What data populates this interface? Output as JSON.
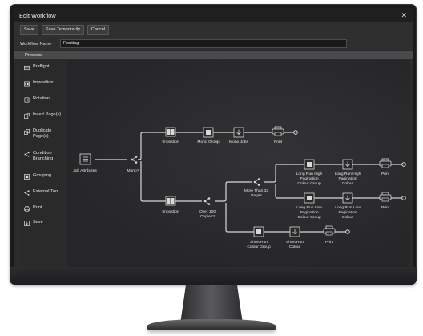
{
  "window": {
    "title": "Edit Workflow",
    "close_glyph": "✕"
  },
  "toolbar": {
    "save": "Save",
    "save_temporarily": "Save Temporarily",
    "cancel": "Cancel"
  },
  "workflow_name": {
    "label": "Workflow Name",
    "value": "Routing"
  },
  "process": {
    "header": "Process"
  },
  "tools": [
    {
      "label": "Preflight",
      "icon": "preflight-icon"
    },
    {
      "label": "Imposition",
      "icon": "imposition-icon"
    },
    {
      "label": "Rotation",
      "icon": "rotation-icon"
    },
    {
      "label": "Insert Page(s)",
      "icon": "insert-page-icon"
    },
    {
      "label": "Duplicate Page(s)",
      "icon": "duplicate-page-icon"
    },
    {
      "label": "Condition Branching",
      "icon": "branch-icon"
    },
    {
      "label": "Grouping",
      "icon": "grouping-icon"
    },
    {
      "label": "External Tool",
      "icon": "share-icon"
    },
    {
      "label": "Print",
      "icon": "printer-icon"
    },
    {
      "label": "Save",
      "icon": "save-icon"
    }
  ],
  "flow": {
    "job_attributes": "Job Attributes",
    "mono_question": "Mono?",
    "imposition_top": "Impostion",
    "mono_group": "Mono Group",
    "mono_jobs": "Mono Jobs",
    "print_top": "Print",
    "imposition_bottom": "Impostion",
    "over_100": "Over 100 Copies?",
    "more_than_32": "More Than 32 Pages",
    "long_high_group": "Long Run High Pagination Colour Group",
    "long_high_colour": "Long Run High Pagination Colour",
    "print_high": "Print",
    "long_low_group": "Long Run Low Pagination Colour Group",
    "long_low_colour": "Long Run Low Pagination Colour",
    "print_low": "Print",
    "short_group": "Short Run Colour Group",
    "short_colour": "Short Run Colour",
    "print_short": "Print"
  }
}
